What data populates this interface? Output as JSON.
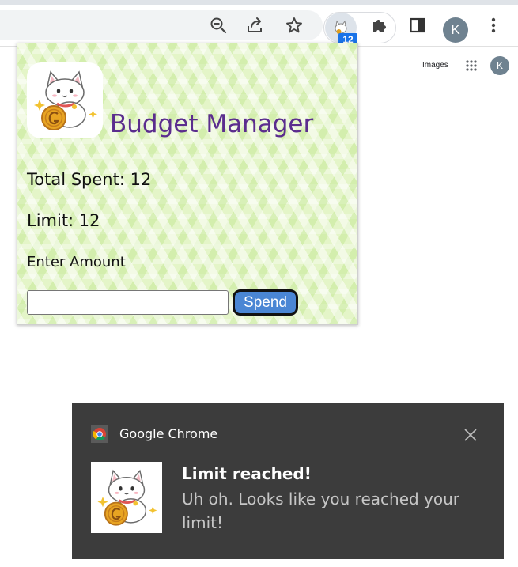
{
  "browser": {
    "extension_badge": "12",
    "profile_initial": "K",
    "toolbar_icons": [
      "zoom-out-icon",
      "share-icon",
      "bookmark-star-icon",
      "extension-icon",
      "puzzle-icon",
      "side-panel-icon",
      "more-vert-icon"
    ],
    "badge_color": "#1a73e8"
  },
  "page": {
    "images_link": "Images",
    "profile_initial": "K"
  },
  "popup": {
    "title": "Budget Manager",
    "total_spent": "Total Spent: 12",
    "limit": "Limit: 12",
    "amount_label": "Enter Amount",
    "amount_value": "",
    "spend_button": "Spend",
    "title_color": "#5b2d8e",
    "button_color": "#4a86d4",
    "background_color": "#e4f5c8"
  },
  "notification": {
    "app_name": "Google Chrome",
    "title": "Limit reached!",
    "message": "Uh oh. Looks like you reached your limit!",
    "background_color": "#3c3c3c"
  }
}
